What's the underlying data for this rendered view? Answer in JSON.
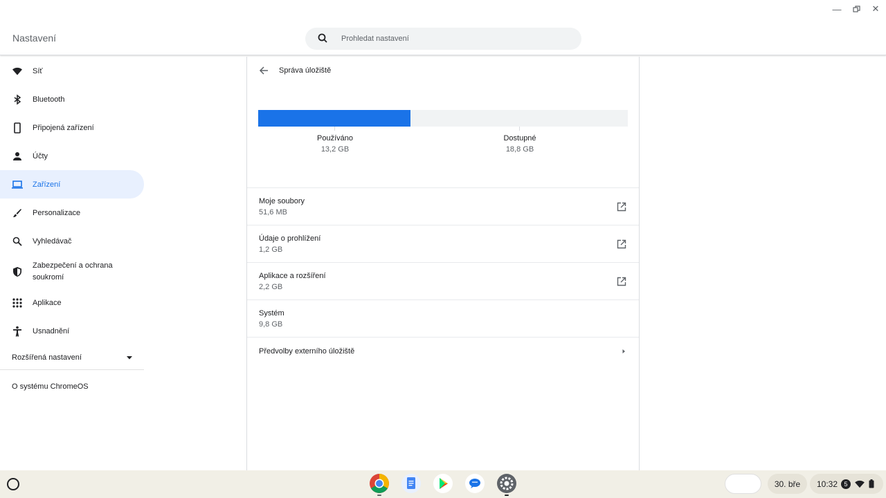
{
  "window": {
    "title": "Nastavení"
  },
  "search": {
    "placeholder": "Prohledat nastavení"
  },
  "sidebar": {
    "items": [
      {
        "label": "Síť",
        "icon": "wifi-icon"
      },
      {
        "label": "Bluetooth",
        "icon": "bluetooth-icon"
      },
      {
        "label": "Připojená zařízení",
        "icon": "phone-icon"
      },
      {
        "label": "Účty",
        "icon": "person-icon"
      },
      {
        "label": "Zařízení",
        "icon": "laptop-icon",
        "active": true
      },
      {
        "label": "Personalizace",
        "icon": "brush-icon"
      },
      {
        "label": "Vyhledávač",
        "icon": "search-icon"
      },
      {
        "label": "Zabezpečení a ochrana soukromí",
        "icon": "shield-icon"
      },
      {
        "label": "Aplikace",
        "icon": "apps-grid-icon"
      },
      {
        "label": "Usnadnění",
        "icon": "accessibility-icon"
      }
    ],
    "advanced_label": "Rozšířená nastavení",
    "about_label": "O systému ChromeOS"
  },
  "page": {
    "title": "Správa úložiště",
    "storage": {
      "used_label": "Používáno",
      "used_value": "13,2 GB",
      "available_label": "Dostupné",
      "available_value": "18,8 GB",
      "used_fraction": 0.4125
    },
    "rows": [
      {
        "label": "Moje soubory",
        "value": "51,6 MB",
        "action": "external-link-icon"
      },
      {
        "label": "Údaje o prohlížení",
        "value": "1,2 GB",
        "action": "external-link-icon"
      },
      {
        "label": "Aplikace a rozšíření",
        "value": "2,2 GB",
        "action": "external-link-icon"
      },
      {
        "label": "Systém",
        "value": "9,8 GB"
      }
    ],
    "external_label": "Předvolby externího úložiště"
  },
  "shelf": {
    "date": "30. bře",
    "time": "10:32",
    "notification_count": "5"
  },
  "colors": {
    "accent": "#1a73e8",
    "active_bg": "#e8f0fe",
    "shelf_bg": "#f1efe6"
  }
}
